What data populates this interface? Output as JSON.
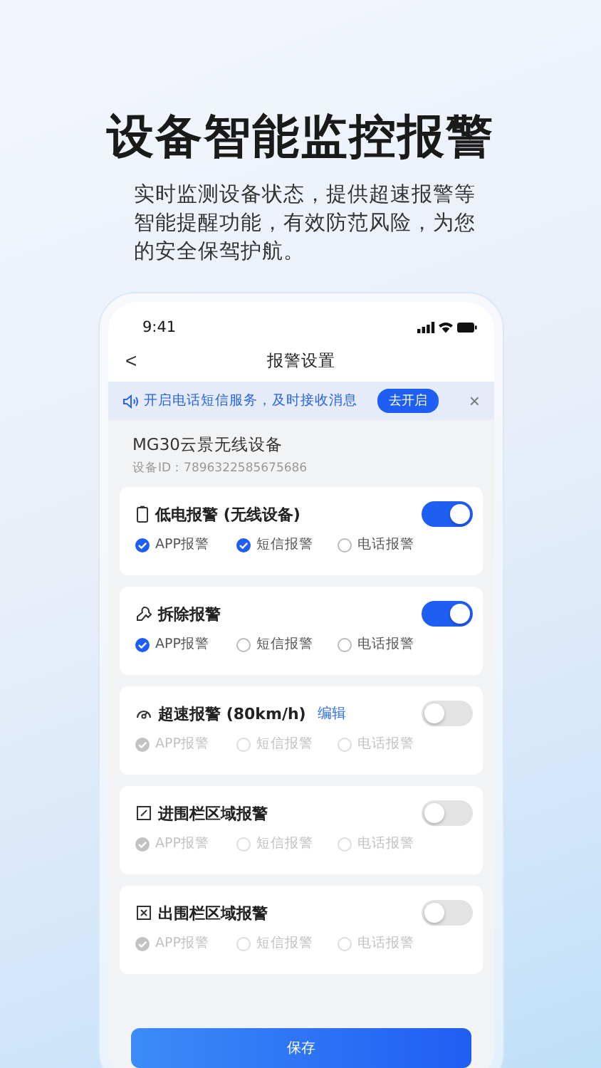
{
  "headline": "设备智能监控报警",
  "subtitle": "实时监测设备状态，提供超速报警等智能提醒功能，有效防范风险，为您的安全保驾护航。",
  "status_bar": {
    "time": "9:41"
  },
  "nav": {
    "back": "<",
    "title": "报警设置"
  },
  "notice": {
    "text": "开启电话短信服务，及时接收消息",
    "action": "去开启",
    "close": "×"
  },
  "device": {
    "name": "MG30云景无线设备",
    "id": "设备ID：7896322585675686"
  },
  "alerts": [
    {
      "kind": "battery",
      "title": "低电报警 (无线设备)",
      "on": true,
      "options": [
        {
          "label": "APP报警",
          "checked": true
        },
        {
          "label": "短信报警",
          "checked": true
        },
        {
          "label": "电话报警",
          "checked": false
        }
      ]
    },
    {
      "kind": "tamper",
      "title": "拆除报警",
      "on": true,
      "options": [
        {
          "label": "APP报警",
          "checked": true
        },
        {
          "label": "短信报警",
          "checked": false
        },
        {
          "label": "电话报警",
          "checked": false
        }
      ]
    },
    {
      "kind": "speed",
      "title": "超速报警 (80km/h)",
      "edit": "编辑",
      "on": false,
      "options": [
        {
          "label": "APP报警",
          "checked": true
        },
        {
          "label": "短信报警",
          "checked": false
        },
        {
          "label": "电话报警",
          "checked": false
        }
      ]
    },
    {
      "kind": "fence_in",
      "title": "进围栏区域报警",
      "on": false,
      "options": [
        {
          "label": "APP报警",
          "checked": true
        },
        {
          "label": "短信报警",
          "checked": false
        },
        {
          "label": "电话报警",
          "checked": false
        }
      ]
    },
    {
      "kind": "fence_out",
      "title": "出围栏区域报警",
      "on": false,
      "options": [
        {
          "label": "APP报警",
          "checked": true
        },
        {
          "label": "短信报警",
          "checked": false
        },
        {
          "label": "电话报警",
          "checked": false
        }
      ]
    }
  ],
  "save_button": "保存"
}
